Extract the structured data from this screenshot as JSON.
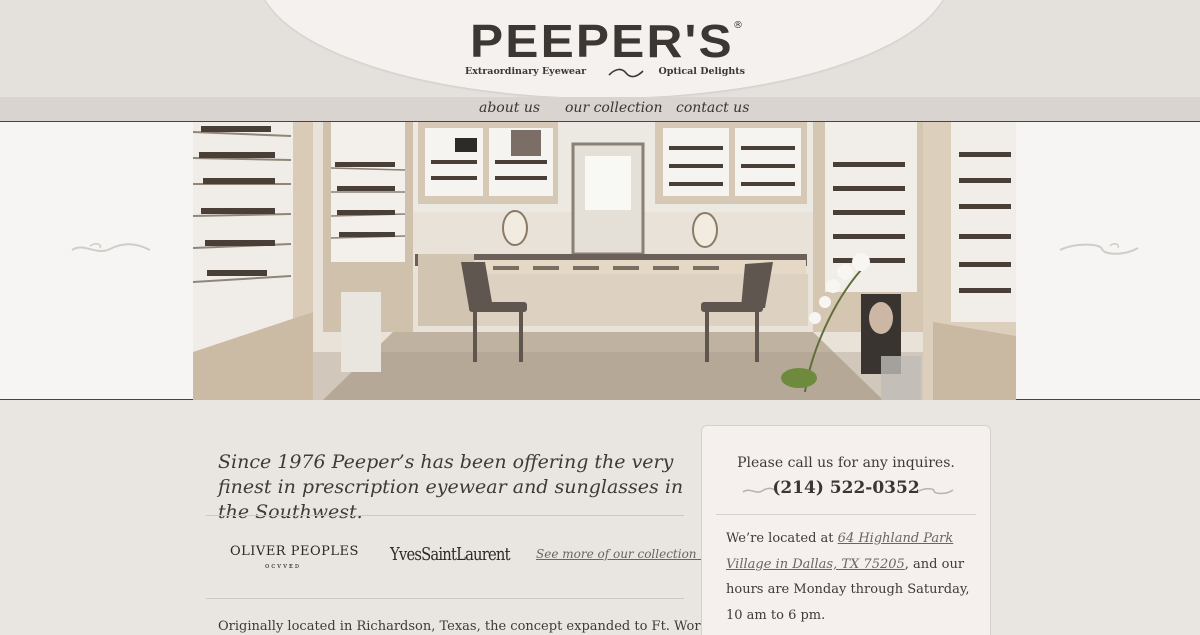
{
  "brand": {
    "name": "PEEPER'S",
    "registered": "®",
    "tagline_left": "Extraordinary Eyewear",
    "tagline_right": "Optical Delights"
  },
  "nav": {
    "items": [
      {
        "label": "about us"
      },
      {
        "label": "our collection"
      },
      {
        "label": "contact us"
      }
    ]
  },
  "hero": {
    "alt": "Interior of the Peeper's optical store with eyewear displays"
  },
  "main": {
    "intro": "Since 1976 Peeper’s has been offering the very finest in prescription eyewear and sunglasses in the Southwest.",
    "brands": {
      "oliver": "OLIVER PEOPLES",
      "oliver_sub": "ᴏᴄᴠᴠᴇᴅ",
      "ysl": "YvesSaintLaurent"
    },
    "see_more": "See more of our collection »",
    "paragraph": "Originally located in Richardson, Texas, the concept expanded to Ft. Worth’s"
  },
  "sidebar": {
    "call_text": "Please call us for any inquires.",
    "phone": "(214) 522-0352",
    "location_prefix": "We’re located at ",
    "address": "64 Highland Park Village in Dallas, TX 75205",
    "location_suffix": ", and our hours are Monday through Saturday, 10 am to 6 pm."
  },
  "colors": {
    "background": "#e9e5e1",
    "accent_text": "#3a3633",
    "link": "#6b6460"
  }
}
